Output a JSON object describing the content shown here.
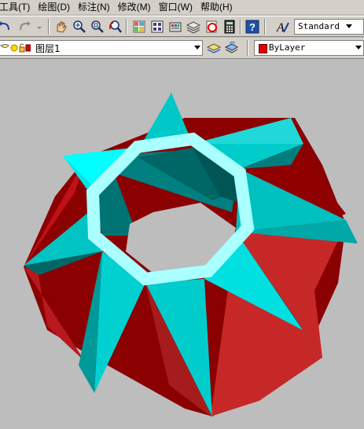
{
  "menubar": {
    "items": [
      "工具(T)",
      "绘图(D)",
      "标注(N)",
      "修改(M)",
      "窗口(W)",
      "帮助(H)"
    ]
  },
  "toolbar": {
    "text_style_value": "Standard",
    "icons": [
      "undo-icon",
      "redo-icon",
      "pan-icon",
      "zoom-realtime-icon",
      "zoom-window-icon",
      "zoom-previous-icon",
      "properties-icon",
      "design-center-icon",
      "tool-palettes-icon",
      "sheet-set-icon",
      "markup-icon",
      "quickcalc-icon",
      "help-icon",
      "text-style-icon"
    ]
  },
  "layerbar": {
    "layer_name": "图层1",
    "color_value": "ByLayer",
    "layer_color": "#e00000"
  },
  "viewport": {
    "background": "#bdbdbd",
    "colors": {
      "spike_cyan": "#00ffff",
      "mid_cyan": "#00cccc",
      "dark_cyan": "#006666",
      "red": "#cc2222",
      "dark_red": "#8b0000",
      "inner_ring": "#aaffff"
    }
  }
}
